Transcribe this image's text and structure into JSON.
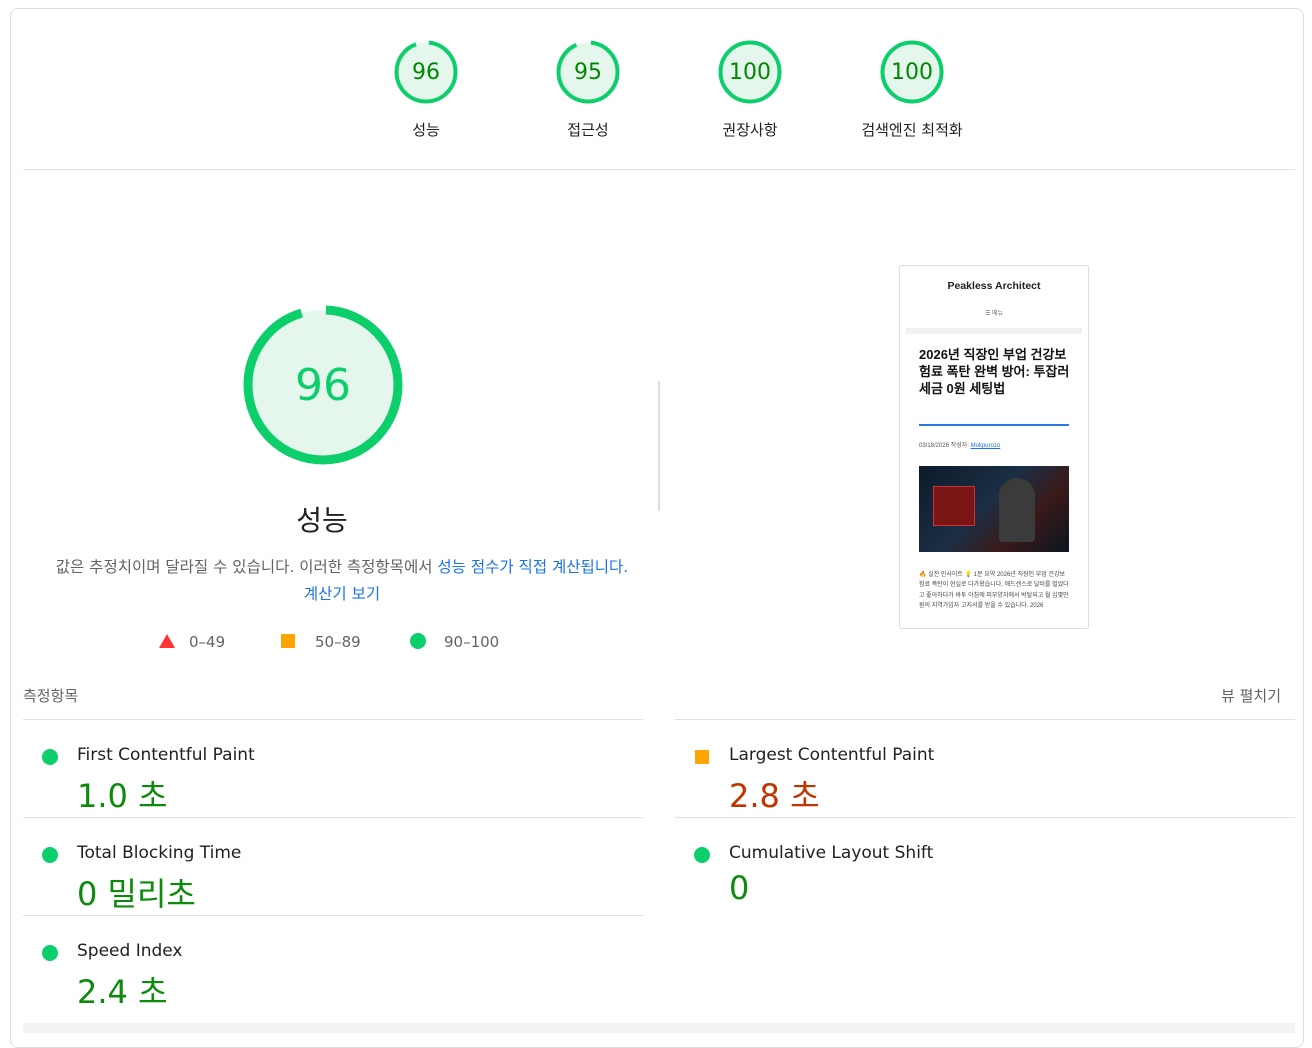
{
  "summary": [
    {
      "score": "96",
      "label": "성능",
      "fraction": 0.96
    },
    {
      "score": "95",
      "label": "접근성",
      "fraction": 0.95
    },
    {
      "score": "100",
      "label": "권장사항",
      "fraction": 1.0
    },
    {
      "score": "100",
      "label": "검색엔진 최적화",
      "fraction": 1.0
    }
  ],
  "performance": {
    "score": "96",
    "fraction": 0.96,
    "title": "성능",
    "desc_text": "값은 추정치이며 달라질 수 있습니다. 이러한 측정항목에서 ",
    "desc_link": "성능 점수가 직접 계산됩니다.",
    "calc_link": "계산기 보기"
  },
  "legend": [
    {
      "shape": "triangle",
      "color": "#ff3333",
      "range": "0–49"
    },
    {
      "shape": "square",
      "color": "#ffa400",
      "range": "50–89"
    },
    {
      "shape": "circle",
      "color": "#0cce6b",
      "range": "90–100"
    }
  ],
  "thumbnail": {
    "site_title": "Peakless Architect",
    "menu": "☰ 메뉴",
    "headline": "2026년 직장인 부업 건강보험료 폭탄 완벽 방어: 투잡러 세금 0원 세팅법",
    "meta_prefix": "03/18/2026 작성자: ",
    "author": "Mokpurozo",
    "body": "🔥 실전 인사이트 💡 1분 요약 2026년 직장인 부업 건강보험료 폭탄이 현실로 다가왔습니다. 애드센스로 달러를 벌었다고 좋아하다가 바투 아침에 피부양자에서 박탈되고 월 십몇만 원의 지역가입자 고지서를 받을 수 있습니다. 2026"
  },
  "metrics": {
    "header": "측정항목",
    "expand": "뷰 펼치기",
    "items": [
      {
        "name": "First Contentful Paint",
        "value": "1.0 초",
        "status": "good"
      },
      {
        "name": "Largest Contentful Paint",
        "value": "2.8 초",
        "status": "average"
      },
      {
        "name": "Total Blocking Time",
        "value": "0 밀리초",
        "status": "good"
      },
      {
        "name": "Cumulative Layout Shift",
        "value": "0",
        "status": "good"
      },
      {
        "name": "Speed Index",
        "value": "2.4 초",
        "status": "good"
      }
    ]
  },
  "colors": {
    "pass": "#0cce6b",
    "pass_fill": "#e5f7ed",
    "pass_text": "#008800",
    "average": "#ffa400",
    "average_text": "#c33300",
    "link": "#1a73e8"
  }
}
